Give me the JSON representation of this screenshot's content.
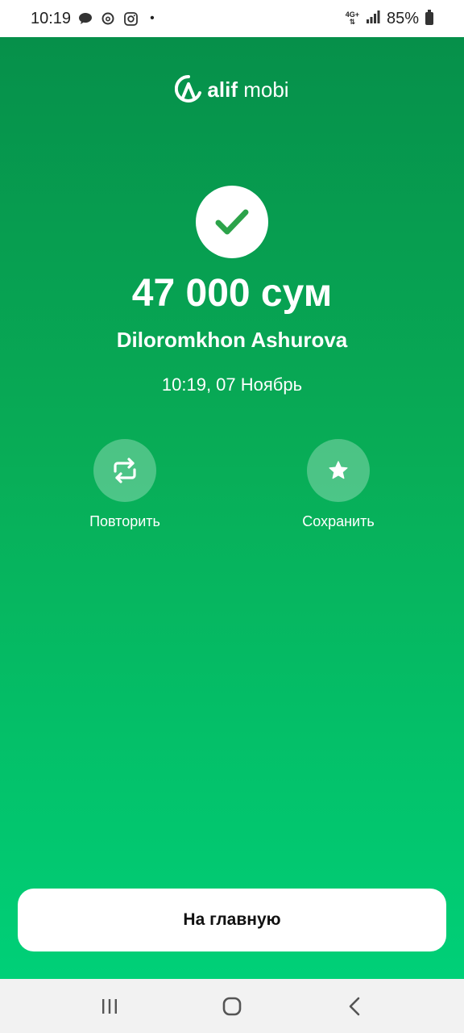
{
  "status_bar": {
    "time": "10:19",
    "network": "4G+",
    "battery": "85%",
    "icons": [
      "chat-icon",
      "threads-icon",
      "instagram-icon",
      "dot-icon",
      "network-icon",
      "signal-icon",
      "battery-icon"
    ]
  },
  "brand": {
    "name_bold": "alif",
    "name_light": "mobi"
  },
  "payment": {
    "amount": "47 000 сум",
    "recipient": "Diloromkhon Ashurova",
    "datetime": "10:19, 07 Ноябрь"
  },
  "actions": {
    "repeat_label": "Повторить",
    "save_label": "Сохранить"
  },
  "home_button_label": "На главную",
  "colors": {
    "accent_top": "#06904a",
    "accent_bottom": "#00d078",
    "check": "#2ca34a"
  }
}
